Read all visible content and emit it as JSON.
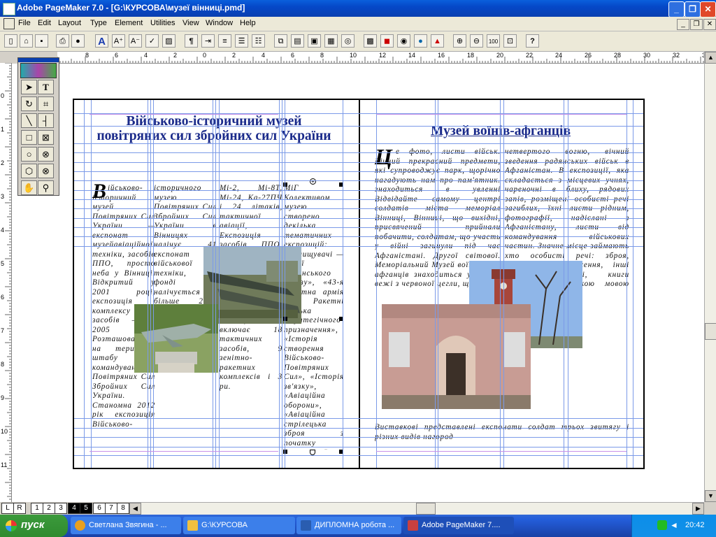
{
  "window": {
    "title": "Adobe PageMaker 7.0 - [G:\\КУРСОВА\\музеї вінниці.pmd]",
    "minimize": "_",
    "restore": "❐",
    "close": "✕"
  },
  "menu": [
    "File",
    "Edit",
    "Layout",
    "Type",
    "Element",
    "Utilities",
    "View",
    "Window",
    "Help"
  ],
  "mdi_buttons": [
    "_",
    "❐",
    "✕"
  ],
  "ruler": {
    "h_labels": [
      "8",
      "6",
      "4",
      "2",
      "0",
      "2",
      "4",
      "6",
      "8",
      "10",
      "12",
      "14",
      "16",
      "18",
      "20",
      "22",
      "24",
      "26",
      "28",
      "30",
      "32",
      "34"
    ],
    "v_labels": [
      "0",
      "1",
      "2",
      "3",
      "4",
      "5",
      "6",
      "7",
      "8",
      "9",
      "10",
      "11"
    ]
  },
  "left_page": {
    "title": "Військово-історичний музей повітряних сил збройних сил України",
    "drop_cap": "В",
    "col1": "ійськово- історичний музей Повітряних Сил України — експонат музейавіаційної техніки, засобів ППО, просто неба у Вінниці. Відкритий у 2001 році, експозиція комплексу засобів — з 2005 року. Розташований на території штабу командування Повітряних Сил Збройних Сил України. Станомна 2012 рік експозиція Військово-",
    "col2": "історичного музею Повітряних Сил Збройних Сил України в Вінницях налічує 41 експонат військової техніки, у фонді налічується більше 2000 предметів. 2005 році, Авіаційна експозиція включає пілотних апаратів — вертольоти.",
    "col3": "Мі-2, Мі-8Т, Мі-24, Ка-27ПЧ і 24 літаків, тактичної авіації, Експозиція засобів ППО, зенітних ракетних комплексів, радіотехнічних військ ППО, відкрита у 2005 році, налічує 12 одиниць, включає 18 тактичних засобів, 9 зенітно-ракетних комплексів і 3 ри.",
    "col4": "МіГ Колективом музею створено декілька тематичних експозицій: «Винищувачі — Герої Радянського Союзу», «43-я Ракетна армія та Ракетні війська стратегічного призначення», «Історія створення Військово-Повітряних Сил», «Історія зв'язку», «Авіаційна оборони», «Авіаційна стрілецька зброя з початку реактивної ери»."
  },
  "right_page": {
    "title": "Музей воїнів-афганців",
    "drop_cap": "Ц",
    "col1": "е фото, листи військ. Вічний прекрасний предмети, які супроводжує парк, щорічно нагадують нам про пам'ятник. знаходиться в увленні Відвідайте самому центрі солдатів міста меморіал Вінниці, Вінниці, що вихідні, присвячений прийнали побачити, солдатам, що участь у війні загинули під час Афганістані. Другої світової. Меморіальний Музей воїнів-парк афганців знаходиться у вічний вежі з червоної цегли, що о",
    "col2": "четвертого вогню, вічний зведення радянських військ в Афганістан. В експозиції, яка складається з місцевих учнях, чареночні в блиху, рядових запів, розміщені особисті речі загиблих, їхні листи рідним, фотографії, надіслані з Афганістану, листи від командування військових частин. Значне місце займають хто особисті речі: зброя, військове спорядження, інші грошові одиниці, книги створені афганською мовою тощо.",
    "col_bottom": "Виставкові представлені експонати солдат трьох звитягу і різних видів нагород"
  },
  "page_tabs": [
    "L",
    "R",
    "1",
    "2",
    "3",
    "4",
    "5",
    "6",
    "7",
    "8"
  ],
  "selected_pages": [
    "4",
    "5"
  ],
  "taskbar": {
    "start": "пуск",
    "tasks": [
      {
        "label": "Светлана Звягина - ...",
        "active": false,
        "icon_color": "#e8a020"
      },
      {
        "label": "G:\\КУРСОВА",
        "active": false,
        "icon_color": "#f0c040"
      },
      {
        "label": "ДИПЛОМНА робота ...",
        "active": false,
        "icon_color": "#2a5db0"
      },
      {
        "label": "Adobe PageMaker 7....",
        "active": true,
        "icon_color": "#c84040"
      }
    ],
    "lang": "EN",
    "time": "20:42"
  },
  "colors": {
    "title_blue": "#1a2a8a",
    "guide": "#7b9ae8",
    "margin_guide": "#c891e8"
  }
}
